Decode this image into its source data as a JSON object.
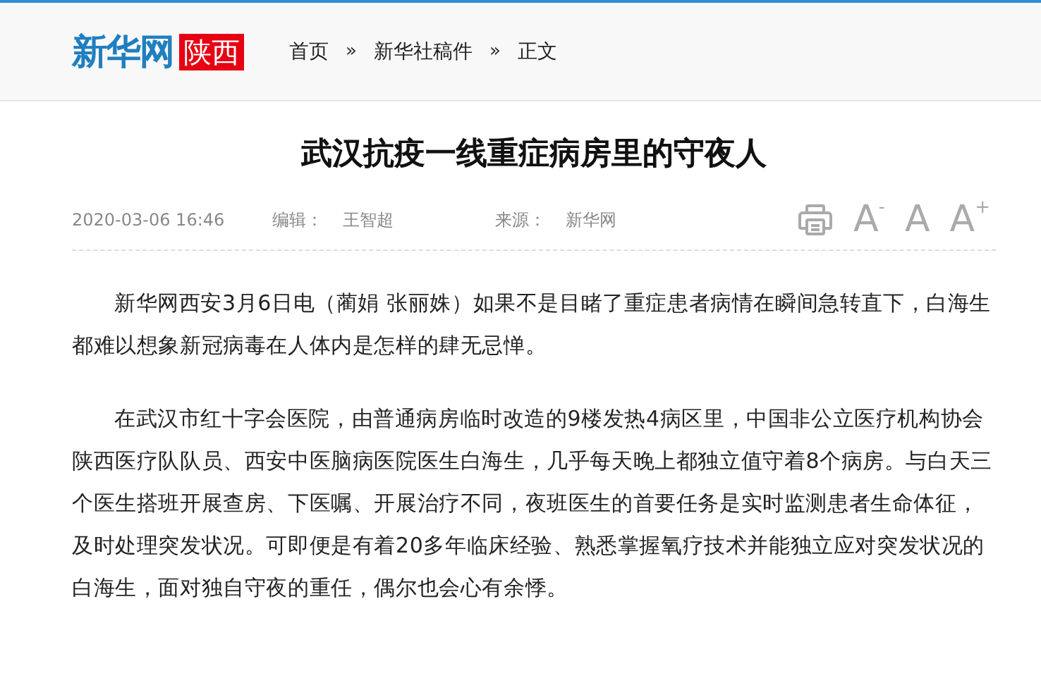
{
  "header": {
    "logo": {
      "name": "新华网",
      "region": "陕西"
    },
    "breadcrumb": [
      {
        "label": "首页"
      },
      {
        "label": "新华社稿件"
      },
      {
        "label": "正文"
      }
    ],
    "separator": "»"
  },
  "article": {
    "title": "武汉抗疫一线重症病房里的守夜人",
    "meta": {
      "date": "2020-03-06 16:46",
      "editor_label": "编辑：",
      "editor": "王智超",
      "source_label": "来源：",
      "source": "新华网"
    },
    "font_buttons": [
      {
        "label": "A",
        "mark": "-"
      },
      {
        "label": "A"
      },
      {
        "label": "A",
        "mark": "+"
      }
    ],
    "paragraphs": [
      "新华网西安3月6日电（蔺娟 张丽姝）如果不是目睹了重症患者病情在瞬间急转直下，白海生都难以想象新冠病毒在人体内是怎样的肆无忌惮。",
      "在武汉市红十字会医院，由普通病房临时改造的9楼发热4病区里，中国非公立医疗机构协会陕西医疗队队员、西安中医脑病医院医生白海生，几乎每天晚上都独立值守着8个病房。与白天三个医生搭班开展查房、下医嘱、开展治疗不同，夜班医生的首要任务是实时监测患者生命体征，及时处理突发状况。可即便是有着20多年临床经验、熟悉掌握氧疗技术并能独立应对突发状况的白海生，面对独自守夜的重任，偶尔也会心有余悸。"
    ]
  }
}
